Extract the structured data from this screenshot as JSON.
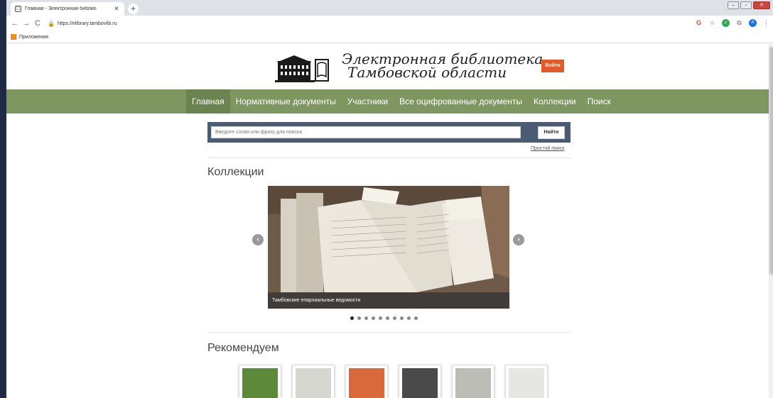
{
  "browser": {
    "tab_title": "Главная - Электронная библио",
    "tab_close": "✕",
    "new_tab": "+",
    "url": "https://elibrary.tambovlib.ru",
    "bookmarks_apps": "Приложения",
    "window_controls": [
      "–",
      "▫",
      "✕"
    ]
  },
  "header": {
    "logo_line1": "Электронная библиотека",
    "logo_line2": "Тамбовской области",
    "login_button": "Войти"
  },
  "nav": {
    "items": [
      {
        "label": "Главная",
        "active": true
      },
      {
        "label": "Нормативные документы",
        "active": false
      },
      {
        "label": "Участники",
        "active": false
      },
      {
        "label": "Все оцифрованные документы",
        "active": false
      },
      {
        "label": "Коллекции",
        "active": false
      },
      {
        "label": "Поиск",
        "active": false
      }
    ]
  },
  "search": {
    "placeholder": "Введите слово или фразу для поиска",
    "button": "Найти",
    "simple_search_link": "Простой поиск"
  },
  "collections": {
    "title": "Коллекции",
    "slide_caption": "Тамбовские епархиальные ведомости",
    "prev_arrow": "‹",
    "next_arrow": "›",
    "dots_total": 10,
    "dots_active_index": 0
  },
  "recommend": {
    "title": "Рекомендуем",
    "items": [
      {
        "cover_color": "#5d8a3a"
      },
      {
        "cover_color": "#d7d7d2"
      },
      {
        "cover_color": "#d9683a"
      },
      {
        "cover_color": "#4a4a4a"
      },
      {
        "cover_color": "#bdbdb8"
      },
      {
        "cover_color": "#e6e6e2"
      }
    ]
  }
}
